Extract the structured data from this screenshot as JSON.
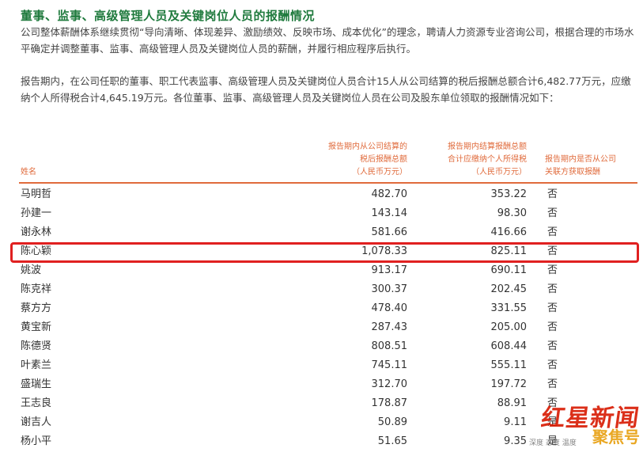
{
  "section": {
    "heading": "董事、监事、高级管理人员及关键岗位人员的报酬情况",
    "paragraph1": "公司整体薪酬体系继续贯彻“导向清晰、体现差异、激励绩效、反映市场、成本优化”的理念，聘请人力资源专业咨询公司，根据合理的市场水平确定并调整董事、监事、高级管理人员及关键岗位人员的薪酬，并履行相应程序后执行。",
    "paragraph2": "报告期内，在公司任职的董事、职工代表监事、高级管理人员及关键岗位人员合计15人从公司结算的税后报酬总额合计6,482.77万元，应缴纳个人所得税合计4,645.19万元。各位董事、监事、高级管理人员及关键岗位人员在公司及股东单位领取的报酬情况如下："
  },
  "table": {
    "headers": {
      "name": "姓名",
      "pay": "报告期内从公司结算的\n税后报酬总额\n（人民币万元）",
      "tax": "报告期内结算报酬总额\n合计应缴纳个人所得税\n（人民币万元）",
      "related": "报告期内是否从公司\n关联方获取报酬"
    },
    "rows": [
      {
        "name": "马明哲",
        "pay": "482.70",
        "tax": "353.22",
        "related": "否"
      },
      {
        "name": "孙建一",
        "pay": "143.14",
        "tax": "98.30",
        "related": "否"
      },
      {
        "name": "谢永林",
        "pay": "581.66",
        "tax": "416.66",
        "related": "否"
      },
      {
        "name": "陈心颖",
        "pay": "1,078.33",
        "tax": "825.11",
        "related": "否"
      },
      {
        "name": "姚波",
        "pay": "913.17",
        "tax": "690.11",
        "related": "否"
      },
      {
        "name": "陈克祥",
        "pay": "300.37",
        "tax": "202.45",
        "related": "否"
      },
      {
        "name": "蔡方方",
        "pay": "478.40",
        "tax": "331.55",
        "related": "否"
      },
      {
        "name": "黄宝新",
        "pay": "287.43",
        "tax": "205.00",
        "related": "否"
      },
      {
        "name": "陈德贤",
        "pay": "808.51",
        "tax": "608.44",
        "related": "否"
      },
      {
        "name": "叶素兰",
        "pay": "745.11",
        "tax": "555.11",
        "related": "否"
      },
      {
        "name": "盛瑞生",
        "pay": "312.70",
        "tax": "197.72",
        "related": "否"
      },
      {
        "name": "王志良",
        "pay": "178.87",
        "tax": "88.91",
        "related": "否"
      },
      {
        "name": "谢吉人",
        "pay": "50.89",
        "tax": "9.11",
        "related": "是"
      },
      {
        "name": "杨小平",
        "pay": "51.65",
        "tax": "9.35",
        "related": "是"
      }
    ],
    "highlighted_row": "陈心颖"
  },
  "watermark": {
    "main": "红星新闻",
    "tag": "聚焦号",
    "sub": "深度 态度 温度"
  },
  "colors": {
    "heading": "#1f7a3d",
    "header_text": "#e06b3c",
    "highlight_border": "#e02020",
    "watermark_red": "#d81e06"
  }
}
